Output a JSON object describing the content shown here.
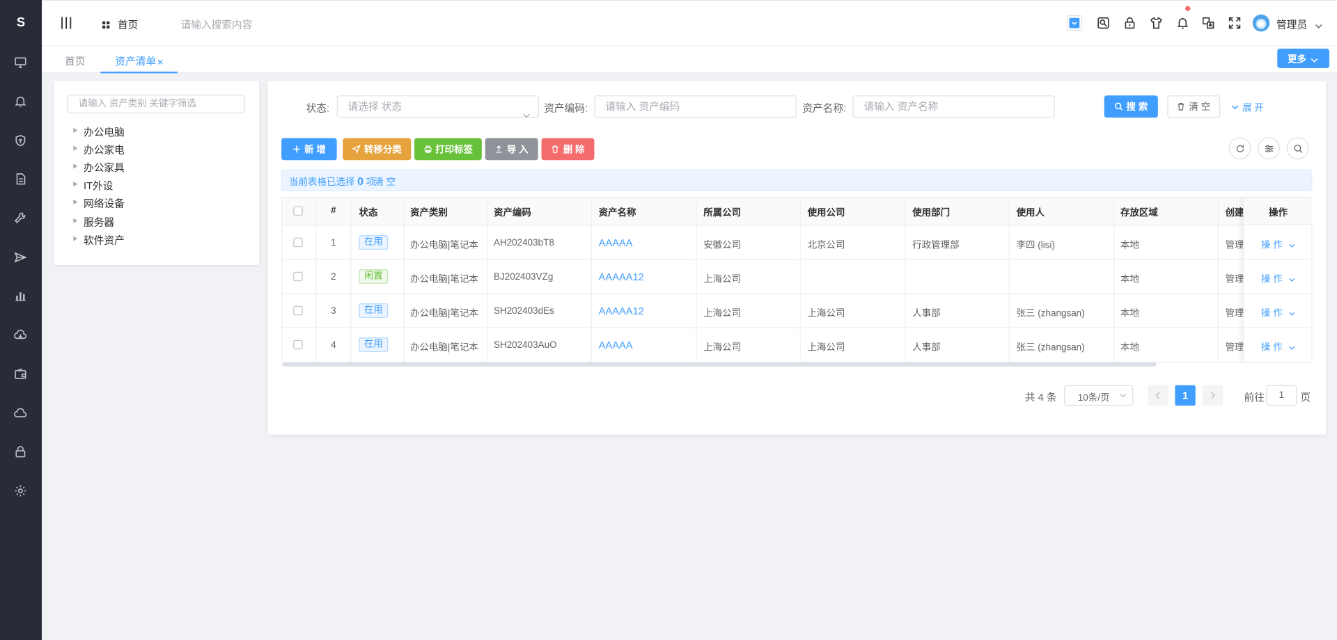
{
  "app": {
    "logo": "S"
  },
  "sidebar": {
    "icons": [
      "monitor-icon",
      "bell-icon",
      "shield-icon",
      "document-icon",
      "wrench-icon",
      "send-icon",
      "bar-chart-icon",
      "cloud-download-icon",
      "wallet-icon",
      "cloud-icon",
      "lock-icon",
      "gear-icon"
    ]
  },
  "header": {
    "home_label": "首页",
    "search_placeholder": "请输入搜索内容",
    "user_name": "管理员",
    "toolbar_icons": [
      "dropdown-icon",
      "image-search-icon",
      "lock-icon",
      "shirt-icon",
      "bell-icon",
      "translate-icon",
      "fullscreen-icon"
    ]
  },
  "tabs": {
    "items": [
      {
        "label": "首页",
        "active": false
      },
      {
        "label": "资产清单",
        "active": true
      }
    ],
    "more_label": "更多"
  },
  "tree": {
    "filter_placeholder": "请输入 资产类别 关键字筛选",
    "items": [
      "办公电脑",
      "办公家电",
      "办公家具",
      "IT外设",
      "网络设备",
      "服务器",
      "软件资产"
    ]
  },
  "search": {
    "status_label": "状态:",
    "status_placeholder": "请选择 状态",
    "code_label": "资产编码:",
    "code_placeholder": "请输入 资产编码",
    "name_label": "资产名称:",
    "name_placeholder": "请输入 资产名称",
    "search_btn": "搜 索",
    "clear_btn": "清 空",
    "expand_btn": "展 开"
  },
  "actions": {
    "add": "新 增",
    "transfer": "转移分类",
    "print": "打印标签",
    "import": "导 入",
    "delete": "删 除"
  },
  "selection": {
    "prefix": "当前表格已选择",
    "count": "0",
    "suffix": "项",
    "clear": "清 空"
  },
  "table": {
    "headers": [
      "#",
      "状态",
      "资产类别",
      "资产编码",
      "资产名称",
      "所属公司",
      "使用公司",
      "使用部门",
      "使用人",
      "存放区域",
      "创建",
      "操作"
    ],
    "rows": [
      {
        "no": "1",
        "status": "在用",
        "category": "办公电脑|笔记本",
        "code": "AH202403bT8",
        "name": "AAAAA",
        "company": "安徽公司",
        "use_company": "北京公司",
        "dept": "行政管理部",
        "user": "李四 (lisi)",
        "area": "本地",
        "creator": "管理",
        "op": "操 作"
      },
      {
        "no": "2",
        "status": "闲置",
        "category": "办公电脑|笔记本",
        "code": "BJ202403VZg",
        "name": "AAAAA12",
        "company": "上海公司",
        "use_company": "",
        "dept": "",
        "user": "",
        "area": "本地",
        "creator": "管理",
        "op": "操 作"
      },
      {
        "no": "3",
        "status": "在用",
        "category": "办公电脑|笔记本",
        "code": "SH202403dEs",
        "name": "AAAAA12",
        "company": "上海公司",
        "use_company": "上海公司",
        "dept": "人事部",
        "user": "张三 (zhangsan)",
        "area": "本地",
        "creator": "管理",
        "op": "操 作"
      },
      {
        "no": "4",
        "status": "在用",
        "category": "办公电脑|笔记本",
        "code": "SH202403AuO",
        "name": "AAAAA",
        "company": "上海公司",
        "use_company": "上海公司",
        "dept": "人事部",
        "user": "张三 (zhangsan)",
        "area": "本地",
        "creator": "管理",
        "op": "操 作"
      }
    ]
  },
  "pagination": {
    "total": "共 4 条",
    "page_size": "10条/页",
    "current_page": "1",
    "goto_prefix": "前往",
    "goto_value": "1",
    "goto_suffix": "页"
  },
  "colors": {
    "primary": "#409eff",
    "sidebar": "#272c37",
    "warning": "#e6a23c",
    "success": "#67c23a",
    "info": "#909399",
    "danger": "#f56c6c"
  }
}
